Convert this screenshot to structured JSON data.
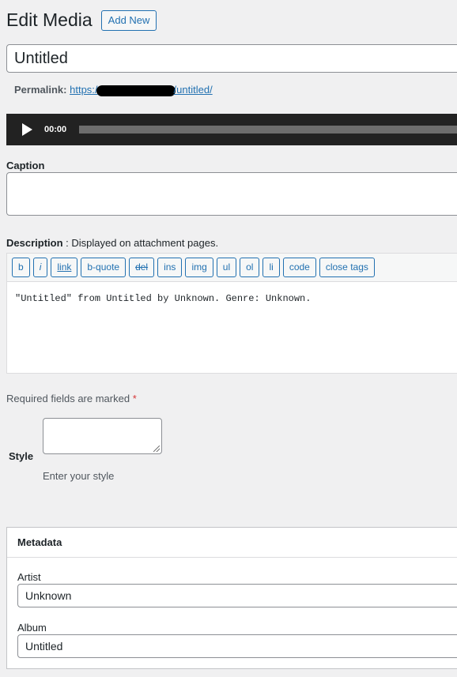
{
  "header": {
    "title": "Edit Media",
    "add_new_label": "Add New"
  },
  "title_field": {
    "value": "Untitled"
  },
  "permalink": {
    "label": "Permalink:",
    "url_prefix": "https:/",
    "url_suffix": "/untitled/"
  },
  "player": {
    "time": "00:00",
    "progress": 0
  },
  "caption": {
    "label": "Caption",
    "value": ""
  },
  "description": {
    "label": "Description",
    "hint": " : Displayed on attachment pages.",
    "toolbar": [
      "b",
      "i",
      "link",
      "b-quote",
      "del",
      "ins",
      "img",
      "ul",
      "ol",
      "li",
      "code",
      "close tags"
    ],
    "content": "\"Untitled\" from Untitled by Unknown. Genre: Unknown."
  },
  "required_note": {
    "text": "Required fields are marked ",
    "star": "*"
  },
  "style_field": {
    "label": "Style",
    "value": "",
    "hint": "Enter your style"
  },
  "metadata": {
    "title": "Metadata",
    "fields": [
      {
        "label": "Artist",
        "value": "Unknown"
      },
      {
        "label": "Album",
        "value": "Untitled"
      }
    ]
  }
}
